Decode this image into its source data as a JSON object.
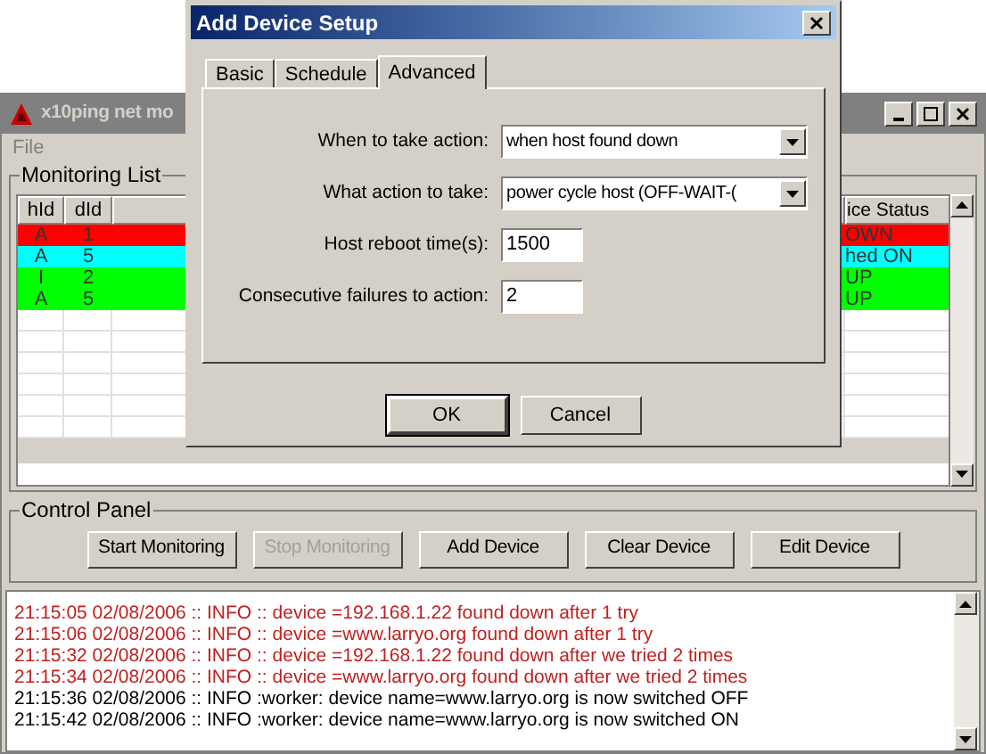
{
  "main_window": {
    "title": "x10ping net mo",
    "menu": [
      "File"
    ],
    "monitoring_list": {
      "title": "Monitoring List",
      "columns": [
        "hId",
        "dId",
        "ice Status"
      ],
      "rows": [
        {
          "hid": "A",
          "did": "1",
          "status": "OWN",
          "color": "#ff0000"
        },
        {
          "hid": "A",
          "did": "5",
          "status": "hed ON",
          "color": "#00ffff"
        },
        {
          "hid": "I",
          "did": "2",
          "status": "UP",
          "color": "#00ff00"
        },
        {
          "hid": "A",
          "did": "5",
          "status": "UP",
          "color": "#00ff00"
        }
      ]
    },
    "control_panel": {
      "title": "Control Panel",
      "buttons": [
        {
          "label": "Start Monitoring",
          "disabled": false
        },
        {
          "label": "Stop Monitoring",
          "disabled": true
        },
        {
          "label": "Add Device",
          "disabled": false
        },
        {
          "label": "Clear Device",
          "disabled": false
        },
        {
          "label": "Edit Device",
          "disabled": false
        }
      ]
    },
    "log": [
      {
        "text": "21:15:05 02/08/2006 :: INFO :: device =192.168.1.22 found down after 1 try",
        "kind": "error"
      },
      {
        "text": "21:15:06 02/08/2006 :: INFO :: device =www.larryo.org found down after 1 try",
        "kind": "error"
      },
      {
        "text": "21:15:32 02/08/2006 :: INFO :: device =192.168.1.22 found down after we tried 2 times",
        "kind": "error"
      },
      {
        "text": "21:15:34 02/08/2006 :: INFO :: device =www.larryo.org found down after we tried 2 times",
        "kind": "error"
      },
      {
        "text": "21:15:36 02/08/2006 :: INFO :worker: device name=www.larryo.org is now switched OFF",
        "kind": "info"
      },
      {
        "text": "21:15:42 02/08/2006 :: INFO :worker: device name=www.larryo.org is now switched ON",
        "kind": "info"
      }
    ]
  },
  "dialog": {
    "title": "Add Device Setup",
    "tabs": [
      {
        "label": "Basic",
        "selected": false
      },
      {
        "label": "Schedule",
        "selected": false
      },
      {
        "label": "Advanced",
        "selected": true
      }
    ],
    "fields": [
      {
        "label": "When to take action:",
        "kind": "dropdown",
        "value": "when host found down"
      },
      {
        "label": "What action to take:",
        "kind": "dropdown",
        "value": "power cycle host (OFF-WAIT-("
      },
      {
        "label": "Host reboot time(s):",
        "kind": "text",
        "value": "1500"
      },
      {
        "label": "Consecutive failures to action:",
        "kind": "text",
        "value": "2"
      }
    ],
    "buttons": [
      "OK",
      "Cancel"
    ]
  }
}
